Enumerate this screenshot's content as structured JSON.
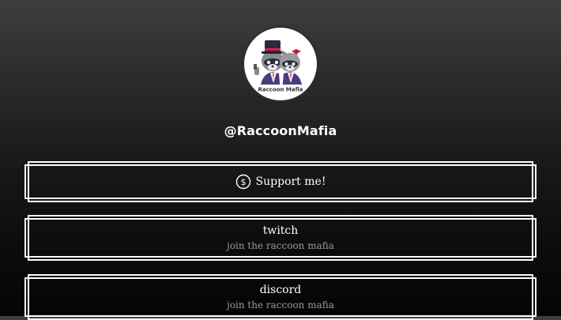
{
  "profile": {
    "handle": "@RaccoonMafia",
    "avatar_icon": "raccoon-mafia-logo",
    "avatar_text": "Raccoon Mafia"
  },
  "links": [
    {
      "title": "Support me!",
      "subtitle": "",
      "icon": "dollar-circle-icon"
    },
    {
      "title": "twitch",
      "subtitle": "join the raccoon mafia"
    },
    {
      "title": "discord",
      "subtitle": "join the raccoon mafia"
    }
  ],
  "colors": {
    "background_top": "#3e3e3e",
    "background_bottom": "#050505",
    "button_border": "#ffffff",
    "subtitle": "#9a9a9a",
    "hat_band": "#d6204f",
    "suit": "#4a3d7a"
  }
}
